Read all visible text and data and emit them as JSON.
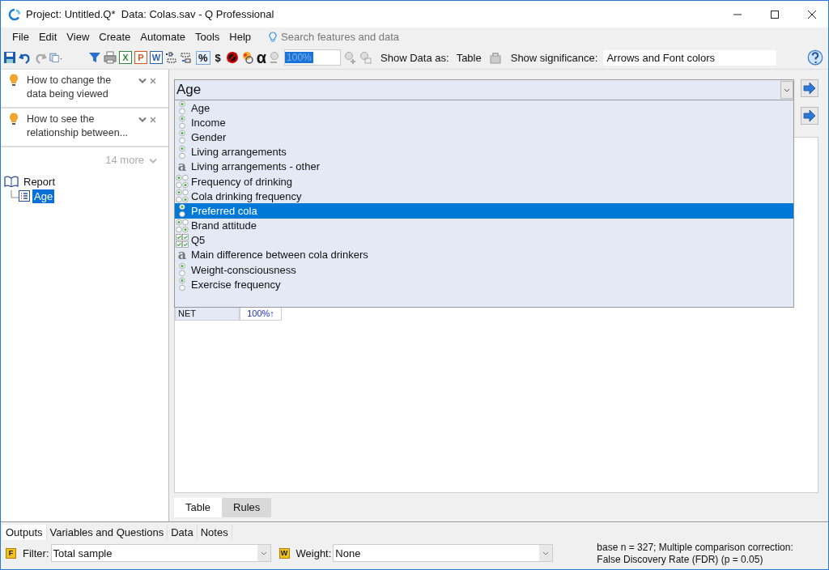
{
  "window": {
    "title": "Project: Untitled.Q*  Data: Colas.sav - Q Professional"
  },
  "menu": [
    "File",
    "Edit",
    "View",
    "Create",
    "Automate",
    "Tools",
    "Help"
  ],
  "search": {
    "placeholder": "Search features and data"
  },
  "toolbar": {
    "exports": [
      {
        "label": "X",
        "color": "#2e8b3a"
      },
      {
        "label": "P",
        "color": "#d9541e"
      },
      {
        "label": "W",
        "color": "#2b5fb4"
      }
    ],
    "glyphs": [
      {
        "glyph": "%",
        "on": true
      },
      {
        "glyph": "$",
        "on": false
      }
    ],
    "alpha": "α",
    "zoom": "100%",
    "show_data_label": "Show Data as:",
    "show_data_value": "Table",
    "significance_label": "Show significance:",
    "significance_value": "Arrows and Font colors"
  },
  "tips": [
    {
      "text": "How to change the data being viewed"
    },
    {
      "text": "How to see the relationship between..."
    }
  ],
  "more": "14 more",
  "tree": [
    {
      "label": "Report",
      "selected": false,
      "children": [
        {
          "label": "Age",
          "selected": true
        }
      ]
    }
  ],
  "combo": {
    "value": "Age"
  },
  "dropdown": [
    {
      "label": "Age",
      "kind": "single",
      "selected": false
    },
    {
      "label": "Income",
      "kind": "single",
      "selected": false
    },
    {
      "label": "Gender",
      "kind": "single",
      "selected": false
    },
    {
      "label": "Living arrangements",
      "kind": "single",
      "selected": false
    },
    {
      "label": "Living arrangements - other",
      "kind": "text",
      "icon": "a",
      "selected": false
    },
    {
      "label": "Frequency of drinking",
      "kind": "grid",
      "selected": false
    },
    {
      "label": "Cola drinking frequency",
      "kind": "grid",
      "selected": false
    },
    {
      "label": "Preferred cola",
      "kind": "single",
      "selected": true
    },
    {
      "label": "Brand attitude",
      "kind": "grid",
      "selected": false
    },
    {
      "label": "Q5",
      "kind": "multi",
      "selected": false
    },
    {
      "label": "Main difference between cola drinkers",
      "kind": "text",
      "icon": "a",
      "selected": false
    },
    {
      "label": "Weight-consciousness",
      "kind": "single",
      "selected": false
    },
    {
      "label": "Exercise frequency",
      "kind": "single",
      "selected": false
    }
  ],
  "table": {
    "row_label": "NET",
    "value": "100%↑"
  },
  "view_tabs": [
    {
      "label": "Table",
      "selected": true
    },
    {
      "label": "Rules",
      "selected": false
    }
  ],
  "bottom_tabs": [
    {
      "label": "Outputs",
      "selected": true
    },
    {
      "label": "Variables and Questions",
      "selected": false
    },
    {
      "label": "Data",
      "selected": false
    },
    {
      "label": "Notes",
      "selected": false
    }
  ],
  "filter": {
    "badge": "F",
    "label": "Filter:",
    "value": "Total sample"
  },
  "weight": {
    "badge": "W",
    "label": "Weight:",
    "value": "None"
  },
  "status": [
    "base n = 327; Multiple comparison correction:",
    "False Discovery Rate (FDR) (p = 0.05)"
  ]
}
